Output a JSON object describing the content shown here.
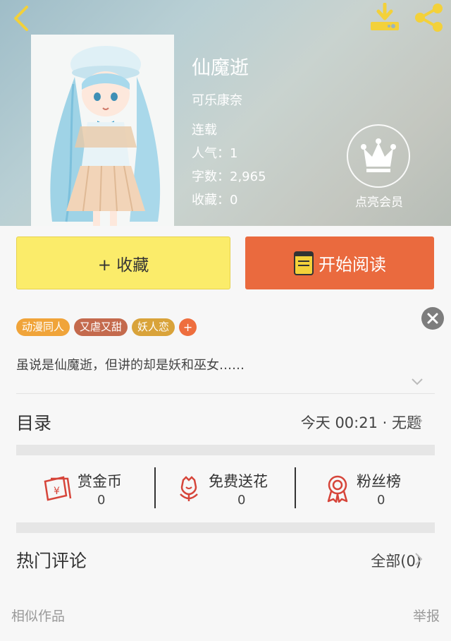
{
  "colors": {
    "accent_orange": "#ea6a3e",
    "collect_yellow": "#fbec6a",
    "icon_red": "#d6453a",
    "icon_yellow": "#f3d13a"
  },
  "header": {
    "back_icon": "chevron-left-icon",
    "download_icon": "download-icon",
    "share_icon": "share-icon"
  },
  "book": {
    "title": "仙魔逝",
    "author": "可乐康奈",
    "status": "连载",
    "popularity": "人气：1",
    "word_count": "字数：2,965",
    "favorites": "收藏：0",
    "vip_label": "点亮会员"
  },
  "actions": {
    "collect_label": "+ 收藏",
    "read_label": "开始阅读"
  },
  "tags": [
    "动漫同人",
    "又虐又甜",
    "妖人恋"
  ],
  "tag_add": "+",
  "summary": "虽说是仙魔逝，但讲的却是妖和巫女……",
  "toc": {
    "title": "目录",
    "latest": "今天 00:21 · 无题"
  },
  "stats": [
    {
      "label": "赏金币",
      "value": "0",
      "icon": "red-envelope-icon"
    },
    {
      "label": "免费送花",
      "value": "0",
      "icon": "flower-icon"
    },
    {
      "label": "粉丝榜",
      "value": "0",
      "icon": "medal-icon"
    }
  ],
  "comments": {
    "title": "热门评论",
    "all_label": "全部(0)"
  },
  "footer": {
    "similar": "相似作品",
    "report": "举报"
  }
}
